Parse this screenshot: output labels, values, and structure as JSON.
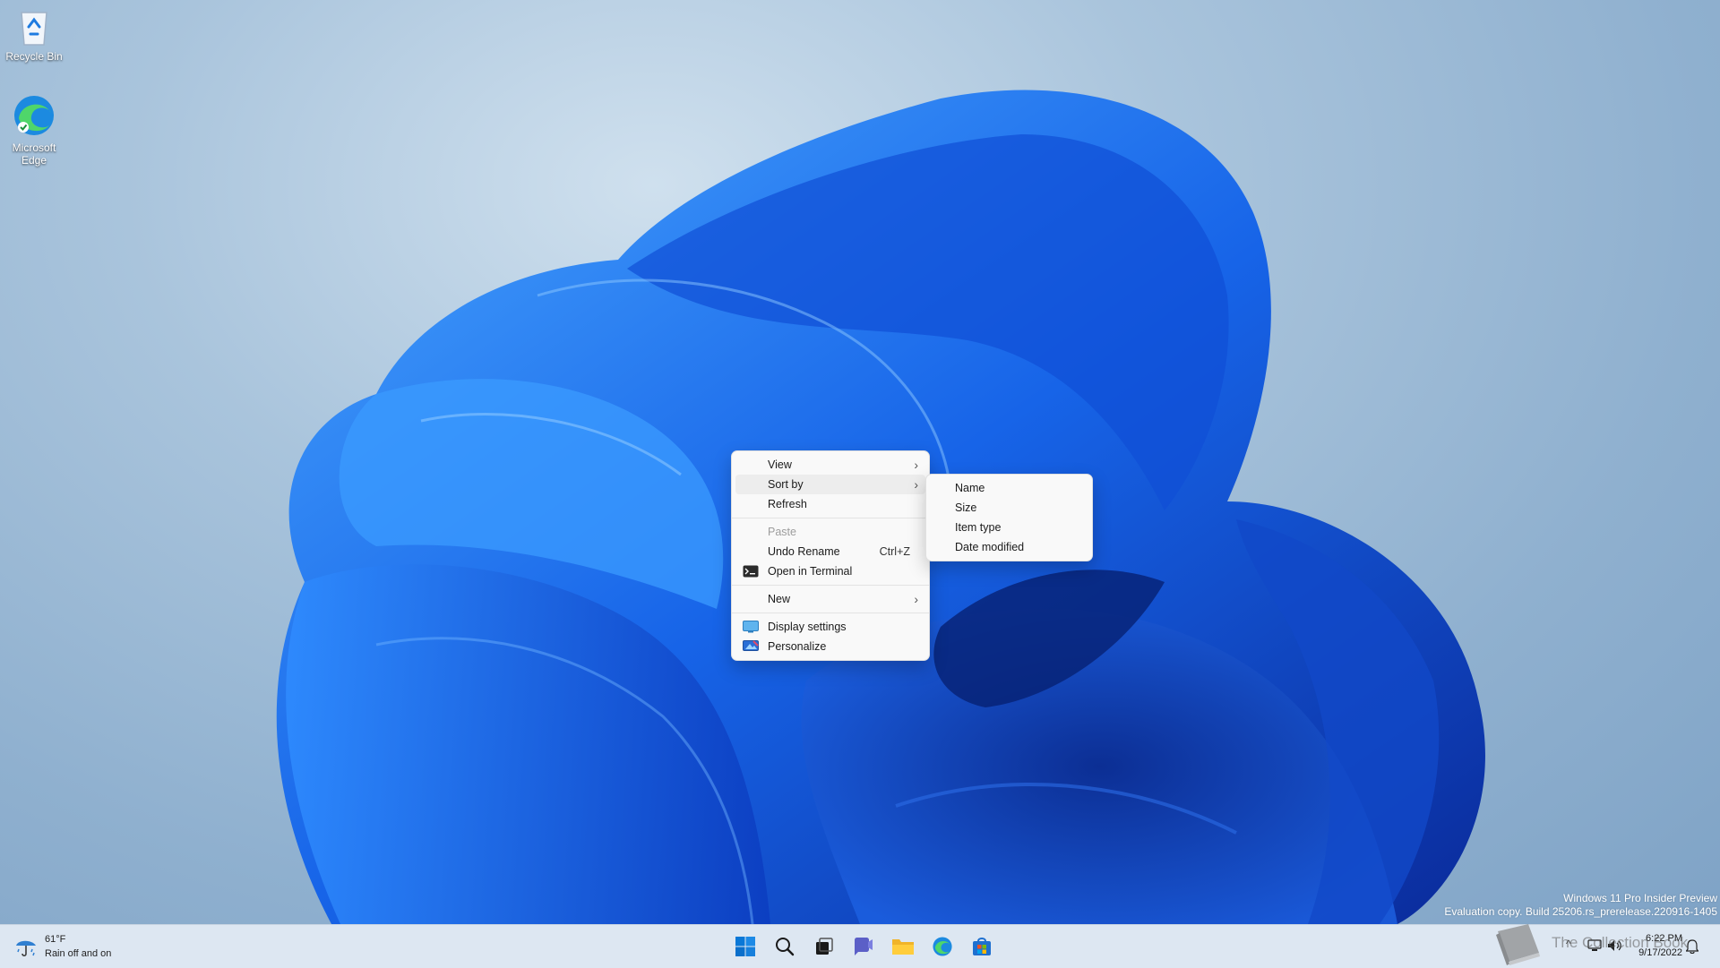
{
  "desktop": {
    "icons": [
      {
        "label": "Recycle Bin",
        "icon": "recycle-bin-icon"
      },
      {
        "label_line1": "Microsoft",
        "label_line2": "Edge",
        "icon": "edge-icon"
      }
    ],
    "watermark": {
      "line1": "Windows 11 Pro Insider Preview",
      "line2": "Evaluation copy. Build 25206.rs_prerelease.220916-1405"
    }
  },
  "context_menu": {
    "items": [
      {
        "label": "View",
        "submenu": true
      },
      {
        "label": "Sort by",
        "submenu": true,
        "highlighted": true
      },
      {
        "label": "Refresh"
      },
      {
        "label": "Paste",
        "disabled": true
      },
      {
        "label": "Undo Rename",
        "shortcut": "Ctrl+Z"
      },
      {
        "label": "Open in Terminal",
        "icon": "terminal-icon"
      },
      {
        "label": "New",
        "submenu": true
      },
      {
        "label": "Display settings",
        "icon": "display-icon"
      },
      {
        "label": "Personalize",
        "icon": "personalize-icon"
      }
    ]
  },
  "sort_submenu": {
    "items": [
      {
        "label": "Name"
      },
      {
        "label": "Size"
      },
      {
        "label": "Item type"
      },
      {
        "label": "Date modified"
      }
    ]
  },
  "taskbar": {
    "weather": {
      "temp": "61°F",
      "condition": "Rain off and on",
      "icon": "rain-icon"
    },
    "apps": [
      "start-icon",
      "search-icon",
      "task-view-icon",
      "chat-icon",
      "file-explorer-icon",
      "edge-icon",
      "store-icon"
    ],
    "tray": {
      "chevron": "^",
      "time": "6:22 PM",
      "date": "9/17/2022"
    }
  },
  "overlay_watermark": {
    "text": "The Collection Book",
    "icon": "book-icon"
  },
  "colors": {
    "accent": "#0067c0",
    "bloom_dark": "#0a2fa8",
    "bloom_mid": "#1a66e6",
    "bloom_light": "#3fa0ff"
  }
}
